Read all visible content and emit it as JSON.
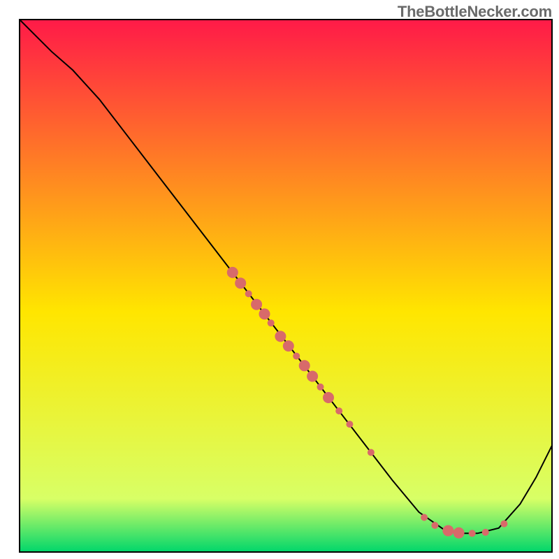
{
  "watermark": "TheBottleNecker.com",
  "chart_data": {
    "type": "line",
    "title": "",
    "xlabel": "",
    "ylabel": "",
    "xlim": [
      0,
      100
    ],
    "ylim": [
      0,
      100
    ],
    "grid": false,
    "legend": false,
    "background_gradient": {
      "top_color": "#ff1a48",
      "mid_color": "#ffe600",
      "bottom_color": "#00d66b"
    },
    "series": [
      {
        "name": "bottleneck-curve",
        "x": [
          0,
          3,
          6,
          10,
          15,
          20,
          25,
          30,
          35,
          40,
          45,
          50,
          55,
          60,
          65,
          70,
          75,
          80,
          83,
          86,
          90,
          94,
          97,
          100
        ],
        "y": [
          100,
          97,
          94,
          90.5,
          85,
          78.5,
          72,
          65.5,
          59,
          52.5,
          46,
          39.5,
          33,
          26.5,
          20,
          13.5,
          7.5,
          4,
          3.5,
          3.5,
          4.5,
          9,
          14,
          20
        ],
        "color": "#000000",
        "width": 2
      }
    ],
    "markers": {
      "name": "sample-points",
      "color": "#d86a6a",
      "radius_small": 5,
      "radius_large": 8,
      "points": [
        {
          "x": 40.0,
          "y": 52.5,
          "r": "large"
        },
        {
          "x": 41.5,
          "y": 50.5,
          "r": "large"
        },
        {
          "x": 43.0,
          "y": 48.5,
          "r": "small"
        },
        {
          "x": 44.5,
          "y": 46.5,
          "r": "large"
        },
        {
          "x": 46.0,
          "y": 44.7,
          "r": "large"
        },
        {
          "x": 47.2,
          "y": 43.0,
          "r": "small"
        },
        {
          "x": 49.0,
          "y": 40.5,
          "r": "large"
        },
        {
          "x": 50.5,
          "y": 38.7,
          "r": "large"
        },
        {
          "x": 52.0,
          "y": 36.8,
          "r": "small"
        },
        {
          "x": 53.5,
          "y": 35.0,
          "r": "large"
        },
        {
          "x": 55.0,
          "y": 33.0,
          "r": "large"
        },
        {
          "x": 56.5,
          "y": 31.0,
          "r": "small"
        },
        {
          "x": 58.0,
          "y": 29.0,
          "r": "large"
        },
        {
          "x": 60.0,
          "y": 26.5,
          "r": "small"
        },
        {
          "x": 62.0,
          "y": 24.0,
          "r": "small"
        },
        {
          "x": 66.0,
          "y": 18.7,
          "r": "small"
        },
        {
          "x": 76.0,
          "y": 6.5,
          "r": "small"
        },
        {
          "x": 78.0,
          "y": 5.0,
          "r": "small"
        },
        {
          "x": 80.5,
          "y": 4.0,
          "r": "large"
        },
        {
          "x": 82.5,
          "y": 3.6,
          "r": "large"
        },
        {
          "x": 85.0,
          "y": 3.5,
          "r": "small"
        },
        {
          "x": 87.5,
          "y": 3.7,
          "r": "small"
        },
        {
          "x": 91.0,
          "y": 5.3,
          "r": "small"
        }
      ]
    }
  }
}
